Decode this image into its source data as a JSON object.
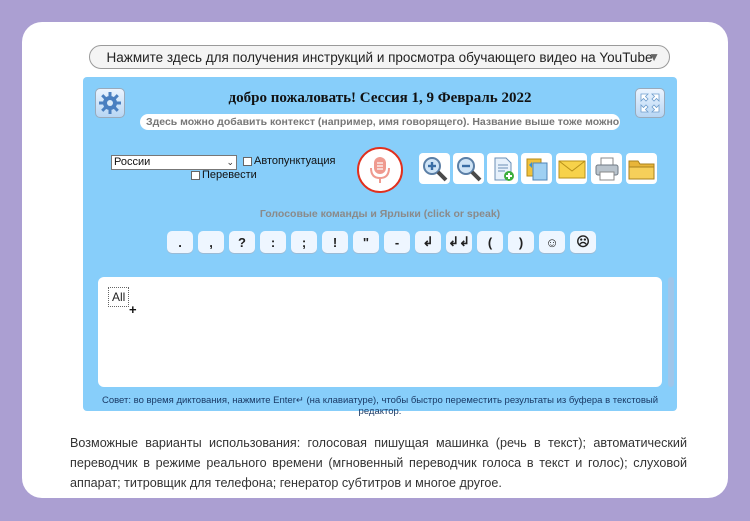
{
  "instructions_bar": {
    "text": "Нажмите здесь для получения инструкций и просмотра обучающего видео на YouTube",
    "arrow_icon": "▼"
  },
  "header": {
    "title": "добро пожаловать!   Сессия 1, 9 Февраль 2022",
    "context_placeholder": "Здесь можно добавить контекст (например, имя говорящего). Название выше тоже можно редактировать"
  },
  "controls": {
    "language": "России",
    "autopunct_label": "Автопунктуация",
    "translate_label": "Перевести"
  },
  "commands": {
    "header": "Голосовые команды и Ярлыки (click or speak)",
    "items": [
      ".",
      ",",
      "?",
      ":",
      ";",
      "!",
      "\"",
      "-",
      "↲",
      "↲↲",
      "(",
      ")",
      "☺",
      "☹"
    ]
  },
  "editor": {
    "selection_text": "All",
    "cursor_glyph": "+"
  },
  "tip": "Совет: во время диктования, нажмите Enter↵ (на клавиатуре), чтобы быстро переместить результаты из буфера в текстовый редактор.",
  "description": "Возможные варианты использования: голосовая пишущая машинка (речь в текст); автоматический переводчик в режиме реального времени (мгновенный переводчик голоса в текст и голос); слуховой аппарат; титровщик для телефона; генератор субтитров и многое другое.",
  "colors": {
    "background": "#ab9fd2",
    "panel": "#87cefa",
    "mic": "#e0301e"
  }
}
